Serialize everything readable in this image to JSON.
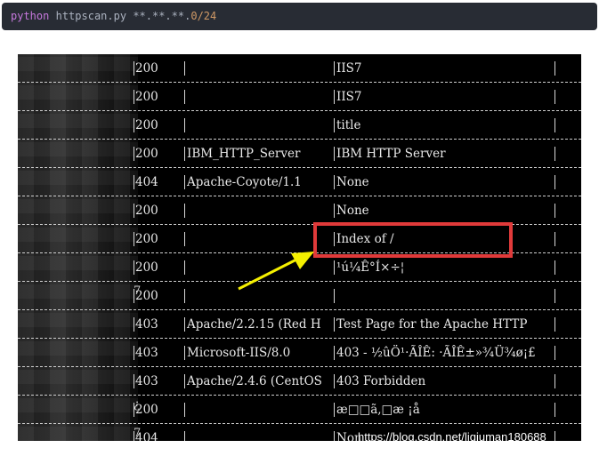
{
  "command": {
    "keyword": "python",
    "script": "httpscan.py",
    "target_masked": "**.**.**.",
    "target_tail": "0/24"
  },
  "rows": [
    {
      "status": "200",
      "server": "",
      "title": "IIS7"
    },
    {
      "status": "200",
      "server": "",
      "title": "IIS7"
    },
    {
      "status": "200",
      "server": "",
      "title": "title"
    },
    {
      "status": "200",
      "server": "IBM_HTTP_Server",
      "title": "IBM HTTP Server"
    },
    {
      "status": "404",
      "server": "Apache-Coyote/1.1",
      "title": "None"
    },
    {
      "status": "200",
      "server": "",
      "title": "None"
    },
    {
      "status": "200",
      "server": "",
      "title": "Index of /"
    },
    {
      "status": "200",
      "server": "",
      "title": "¹ú¼Ê°Í×÷¦"
    },
    {
      "status": "200",
      "server": "",
      "title": ""
    },
    {
      "status": "403",
      "server": "Apache/2.2.15 (Red H",
      "title": "Test Page for the Apache HTTP"
    },
    {
      "status": "403",
      "server": "Microsoft-IIS/8.0",
      "title": "403 - ½ûÖ¹·ÃÎÊ: ·ÃÎÊ±»¾Ü¾ø¡£"
    },
    {
      "status": "403",
      "server": "Apache/2.4.6 (CentOS",
      "title": "403 Forbidden"
    },
    {
      "status": "200",
      "server": "",
      "title": "æ□□ã,□æ ¡å"
    },
    {
      "status": "404",
      "server": "",
      "title": "Non"
    }
  ],
  "edge_fragments": [
    "7",
    "¿",
    "7"
  ],
  "watermark": "https://blog.csdn.net/liqiuman180688",
  "colors": {
    "terminal_bg": "#000000",
    "highlight_box": "#e03a3a",
    "arrow": "#f5f000"
  }
}
